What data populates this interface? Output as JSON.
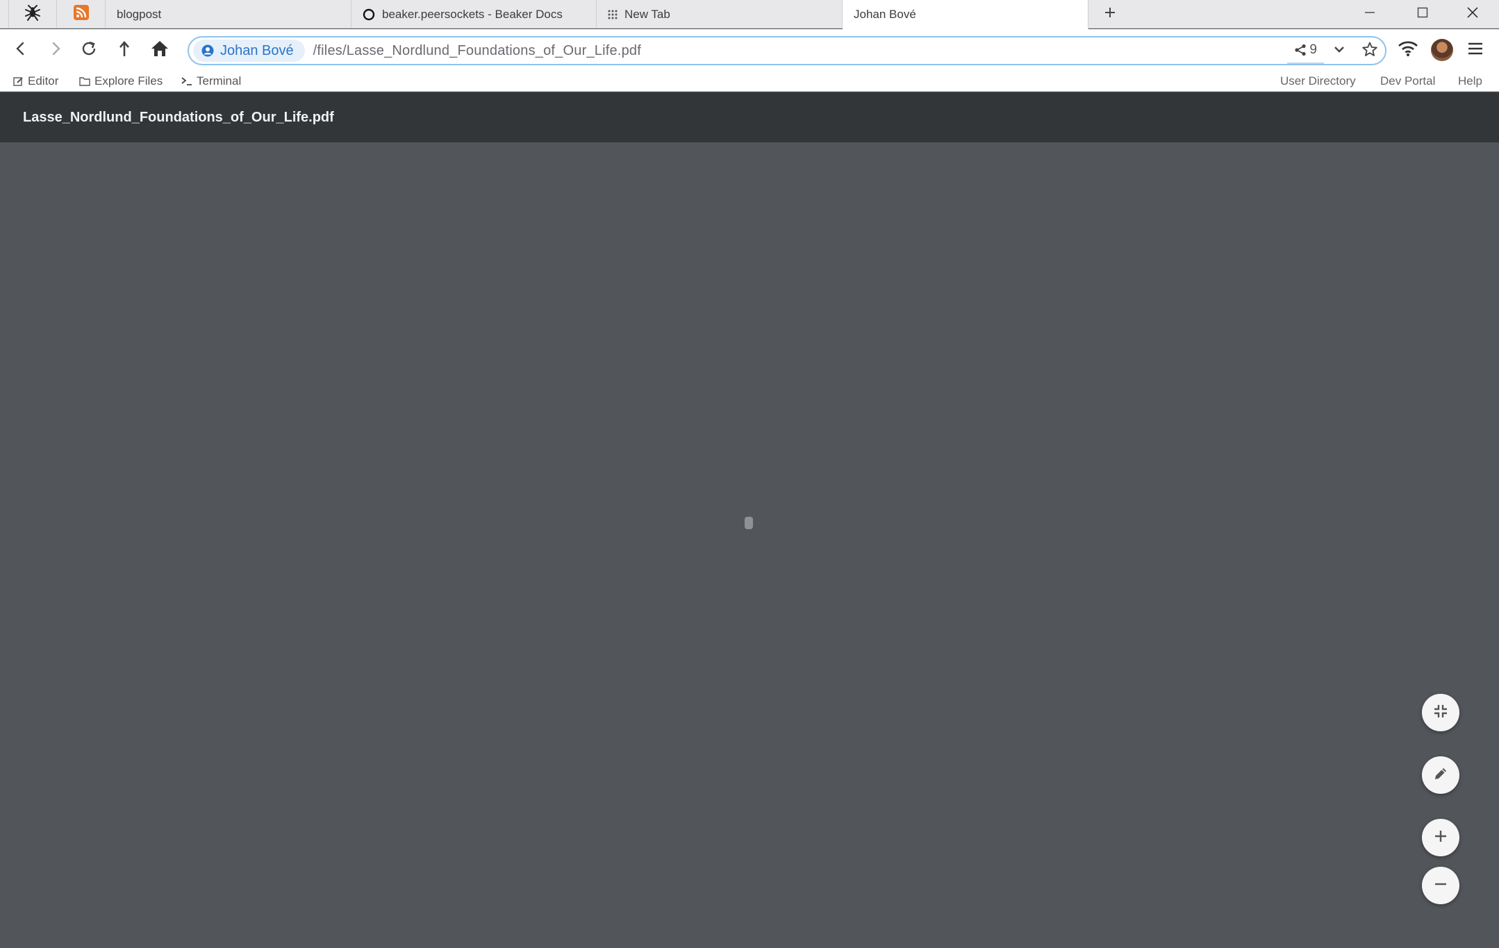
{
  "browser": {
    "pinned_tabs": [
      {
        "icon": "spider-icon"
      },
      {
        "icon": "rss-feed-icon",
        "color": "#e8762b"
      }
    ],
    "tabs": [
      {
        "label": "blogpost",
        "icon": ""
      },
      {
        "label": "beaker.peersockets - Beaker Docs",
        "icon": "circle-icon"
      },
      {
        "label": "New Tab",
        "icon": "grid-icon"
      },
      {
        "label": "Johan Bové",
        "icon": "",
        "active": true
      }
    ],
    "address_bar": {
      "identity_label": "Johan Bové",
      "path": "/files/Lasse_Nordlund_Foundations_of_Our_Life.pdf",
      "peer_count": "9"
    },
    "accent_color": "#2a74c9"
  },
  "subbar": {
    "left": [
      {
        "label": "Editor",
        "icon": "edit-icon"
      },
      {
        "label": "Explore Files",
        "icon": "folder-icon"
      },
      {
        "label": "Terminal",
        "icon": "terminal-icon"
      }
    ],
    "right": [
      {
        "label": "User Directory"
      },
      {
        "label": "Dev Portal"
      },
      {
        "label": "Help"
      }
    ]
  },
  "viewer": {
    "title": "Lasse_Nordlund_Foundations_of_Our_Life.pdf",
    "background_color": "#52565a",
    "header_color": "#323639"
  }
}
